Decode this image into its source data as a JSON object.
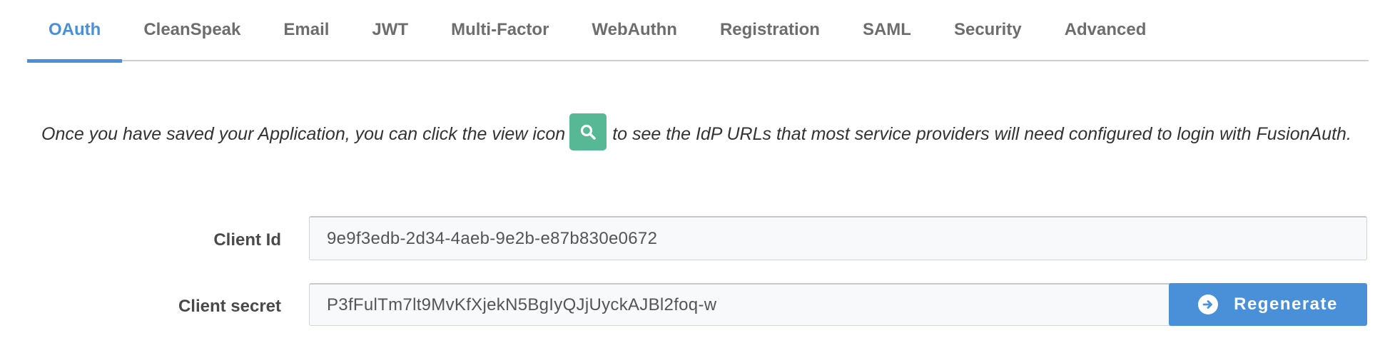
{
  "tabs": [
    {
      "label": "OAuth",
      "active": true
    },
    {
      "label": "CleanSpeak",
      "active": false
    },
    {
      "label": "Email",
      "active": false
    },
    {
      "label": "JWT",
      "active": false
    },
    {
      "label": "Multi-Factor",
      "active": false
    },
    {
      "label": "WebAuthn",
      "active": false
    },
    {
      "label": "Registration",
      "active": false
    },
    {
      "label": "SAML",
      "active": false
    },
    {
      "label": "Security",
      "active": false
    },
    {
      "label": "Advanced",
      "active": false
    }
  ],
  "info": {
    "text_before": "Once you have saved your Application, you can click the view icon",
    "icon": "search-icon",
    "text_after": "to see the IdP URLs that most service providers will need configured to login with FusionAuth."
  },
  "client_id": {
    "label": "Client Id",
    "value": "9e9f3edb-2d34-4aeb-9e2b-e87b830e0672"
  },
  "client_secret": {
    "label": "Client secret",
    "value": "P3fFulTm7lt9MvKfXjekN5BgIyQJjUyckAJBl2foq-w"
  },
  "regenerate": {
    "label": "Regenerate",
    "icon": "arrow-circle-right-icon"
  },
  "colors": {
    "accent": "#4a90d9",
    "view_button": "#57b895",
    "tab_text": "#6d6d6d"
  }
}
